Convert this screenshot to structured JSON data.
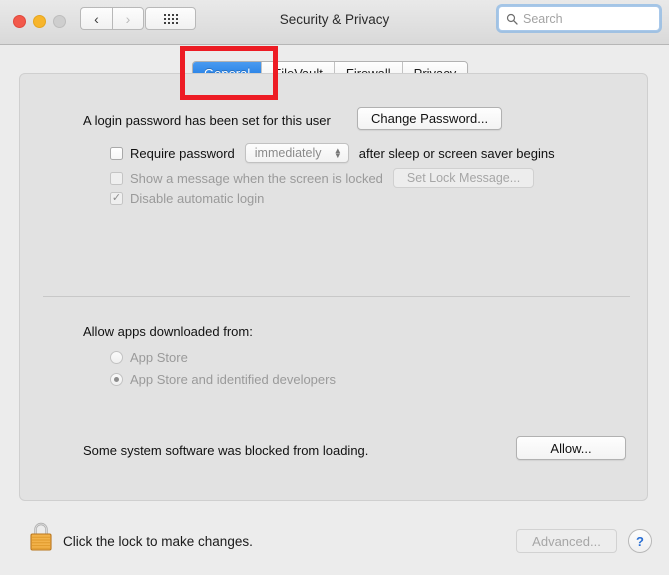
{
  "window": {
    "title": "Security & Privacy",
    "traffic_lights": [
      "close",
      "minimize",
      "zoom"
    ],
    "nav": {
      "back": "‹",
      "forward": "›"
    },
    "grid_button": "show-all-icon"
  },
  "search": {
    "placeholder": "Search",
    "value": "",
    "icon": "search-icon"
  },
  "tabs": [
    {
      "label": "General",
      "active": true
    },
    {
      "label": "FileVault",
      "active": false
    },
    {
      "label": "Firewall",
      "active": false
    },
    {
      "label": "Privacy",
      "active": false
    }
  ],
  "highlight": {
    "color": "#ed1c24",
    "target": "General"
  },
  "general": {
    "login_password_text": "A login password has been set for this user",
    "change_password_label": "Change Password...",
    "require_password": {
      "label": "Require password",
      "checked": false,
      "delay_value": "immediately",
      "suffix_text": "after sleep or screen saver begins"
    },
    "show_message": {
      "label": "Show a message when the screen is locked",
      "checked": false,
      "button_label": "Set Lock Message...",
      "disabled": true
    },
    "disable_auto_login": {
      "label": "Disable automatic login",
      "checked": true,
      "disabled": true
    }
  },
  "gatekeeper": {
    "heading": "Allow apps downloaded from:",
    "options": [
      {
        "label": "App Store",
        "selected": false,
        "disabled": true
      },
      {
        "label": "App Store and identified developers",
        "selected": true,
        "disabled": true
      }
    ]
  },
  "blocked": {
    "message": "Some system software was blocked from loading.",
    "allow_label": "Allow..."
  },
  "footer": {
    "lock_icon": "lock-closed-icon",
    "lock_text": "Click the lock to make changes.",
    "advanced_label": "Advanced...",
    "advanced_disabled": true,
    "help_label": "?"
  }
}
